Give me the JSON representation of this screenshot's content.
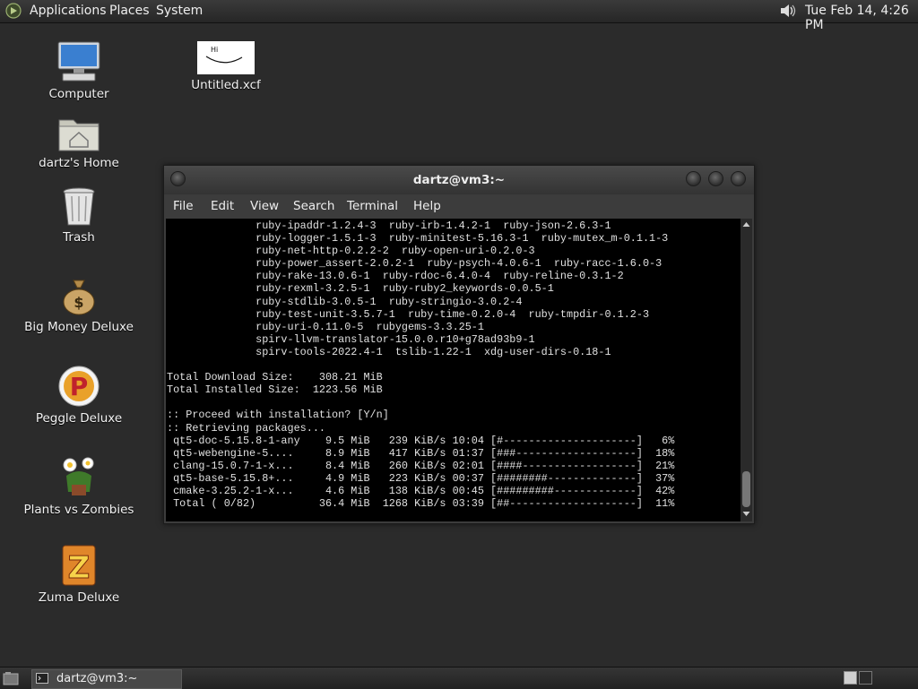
{
  "top_panel": {
    "applications": "Applications",
    "places": "Places",
    "system": "System",
    "clock": "Tue Feb 14,  4:26 PM"
  },
  "desktop_icons": {
    "computer": "Computer",
    "untitled_xcf": "Untitled.xcf",
    "xcf_thumb_text": "Hi",
    "home": "dartz's Home",
    "trash": "Trash",
    "big_money": "Big Money Deluxe",
    "peggle": "Peggle Deluxe",
    "plants": "Plants vs Zombies",
    "zuma": "Zuma Deluxe"
  },
  "terminal": {
    "title": "dartz@vm3:~",
    "menu": [
      "File",
      "Edit",
      "View",
      "Search",
      "Terminal",
      "Help"
    ],
    "lines": [
      "              ruby-ipaddr-1.2.4-3  ruby-irb-1.4.2-1  ruby-json-2.6.3-1",
      "              ruby-logger-1.5.1-3  ruby-minitest-5.16.3-1  ruby-mutex_m-0.1.1-3",
      "              ruby-net-http-0.2.2-2  ruby-open-uri-0.2.0-3",
      "              ruby-power_assert-2.0.2-1  ruby-psych-4.0.6-1  ruby-racc-1.6.0-3",
      "              ruby-rake-13.0.6-1  ruby-rdoc-6.4.0-4  ruby-reline-0.3.1-2",
      "              ruby-rexml-3.2.5-1  ruby-ruby2_keywords-0.0.5-1",
      "              ruby-stdlib-3.0.5-1  ruby-stringio-3.0.2-4",
      "              ruby-test-unit-3.5.7-1  ruby-time-0.2.0-4  ruby-tmpdir-0.1.2-3",
      "              ruby-uri-0.11.0-5  rubygems-3.3.25-1",
      "              spirv-llvm-translator-15.0.0.r10+g78ad93b9-1",
      "              spirv-tools-2022.4-1  tslib-1.22-1  xdg-user-dirs-0.18-1",
      "",
      "Total Download Size:    308.21 MiB",
      "Total Installed Size:  1223.56 MiB",
      "",
      ":: Proceed with installation? [Y/n]",
      ":: Retrieving packages...",
      " qt5-doc-5.15.8-1-any    9.5 MiB   239 KiB/s 10:04 [#---------------------]   6%",
      " qt5-webengine-5....     8.9 MiB   417 KiB/s 01:37 [###-------------------]  18%",
      " clang-15.0.7-1-x...     8.4 MiB   260 KiB/s 02:01 [####------------------]  21%",
      " qt5-base-5.15.8+...     4.9 MiB   223 KiB/s 00:37 [########--------------]  37%",
      " cmake-3.25.2-1-x...     4.6 MiB   138 KiB/s 00:45 [#########-------------]  42%",
      " Total ( 0/82)          36.4 MiB  1268 KiB/s 03:39 [##--------------------]  11%"
    ]
  },
  "taskbar": {
    "terminal_task": "dartz@vm3:~"
  }
}
